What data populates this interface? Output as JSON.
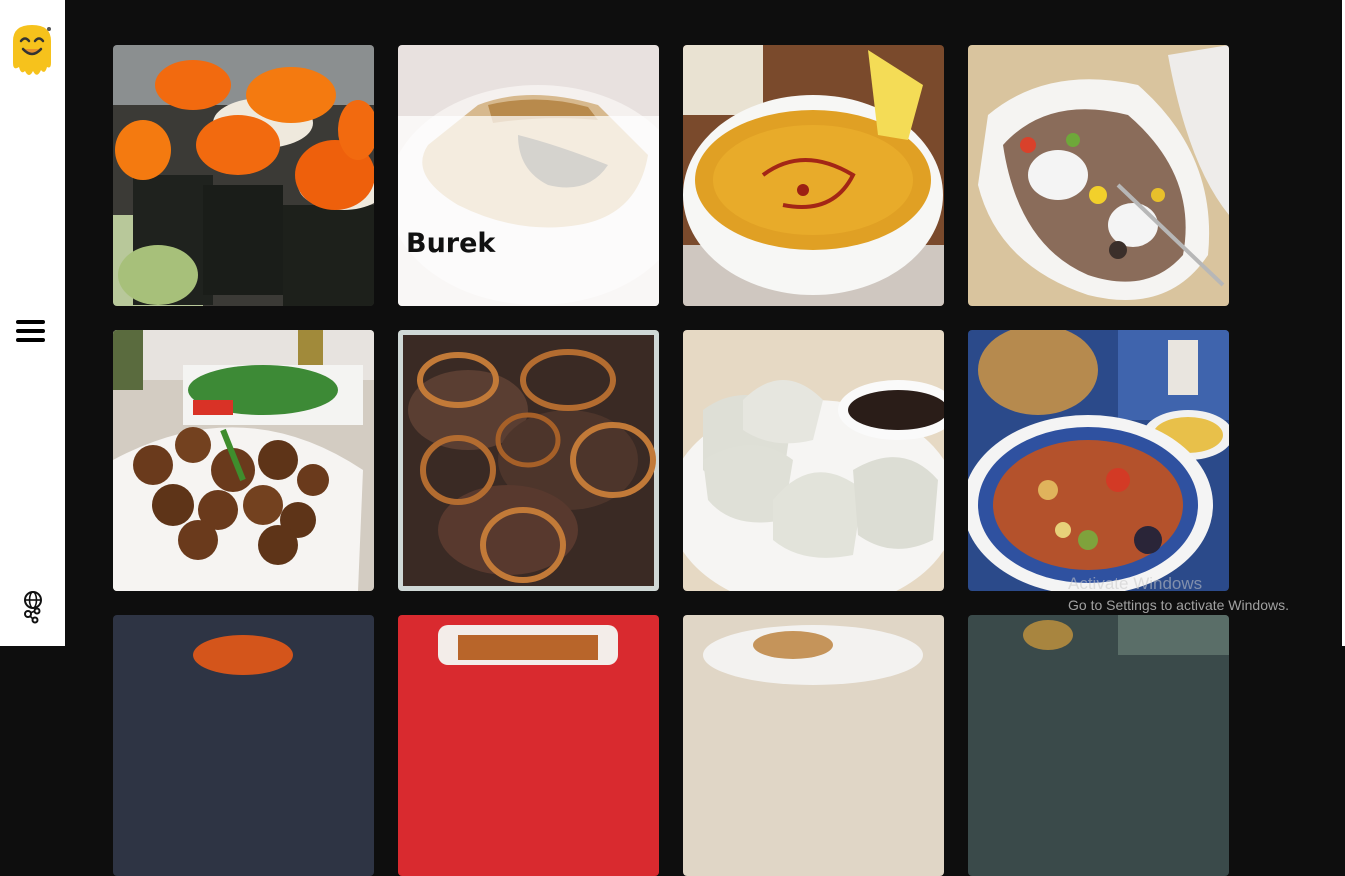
{
  "sidebar": {
    "logo_icon": "smiling-yellow-face-logo",
    "menu_icon": "hamburger-menu-icon",
    "language_icon": "globe-language-icon"
  },
  "cards": [
    {
      "dish": "sushi rolls",
      "label": ""
    },
    {
      "dish": "burek",
      "label": "Burek"
    },
    {
      "dish": "lentil soup",
      "label": ""
    },
    {
      "dish": "stuffed baked potato",
      "label": ""
    },
    {
      "dish": "falafel",
      "label": ""
    },
    {
      "dish": "liver with onions",
      "label": ""
    },
    {
      "dish": "dumplings",
      "label": ""
    },
    {
      "dish": "vegetable stew",
      "label": ""
    },
    {
      "dish": "dish",
      "label": ""
    },
    {
      "dish": "dish",
      "label": ""
    },
    {
      "dish": "dish",
      "label": ""
    },
    {
      "dish": "dish",
      "label": ""
    }
  ],
  "watermark": {
    "title": "Activate Windows",
    "subtitle": "Go to Settings to activate Windows."
  }
}
